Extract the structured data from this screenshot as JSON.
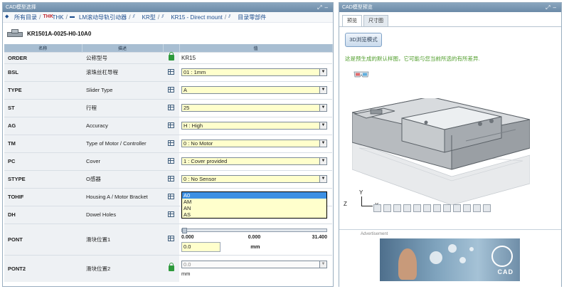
{
  "left_panel": {
    "title": "CAD模型选择",
    "breadcrumb": [
      {
        "label": "所有目录",
        "icon": "catalog-icon"
      },
      {
        "label": "THK",
        "icon": "thk-logo",
        "logo_text": "THK"
      },
      {
        "label": "LM滚动导轨引动器",
        "icon": "guide-icon"
      },
      {
        "label": "KR型",
        "icon": "actuator-icon"
      },
      {
        "label": "KR15 - Direct mount",
        "icon": "actuator-icon"
      },
      {
        "label": "目录零部件",
        "icon": "part-icon"
      }
    ],
    "part_name": "KR1501A-0025-H0-10A0",
    "table": {
      "headers": {
        "name": "名称",
        "description": "描述",
        "value": "值"
      },
      "rows": [
        {
          "key": "ORDER",
          "desc": "公称型号",
          "icon": "lock-icon",
          "value": "KR15"
        },
        {
          "key": "BSL",
          "desc": "滚珠丝杠导程",
          "icon": "table-icon",
          "value": "01 : 1mm"
        },
        {
          "key": "TYPE",
          "desc": "Slider Type",
          "icon": "table-icon",
          "value": "A"
        },
        {
          "key": "ST",
          "desc": "行程",
          "icon": "table-icon",
          "value": "25"
        },
        {
          "key": "AG",
          "desc": "Accuracy",
          "icon": "table-icon",
          "value": "H : High"
        },
        {
          "key": "TM",
          "desc": "Type of Motor / Controller",
          "icon": "table-icon",
          "value": "0 : No Motor"
        },
        {
          "key": "PC",
          "desc": "Cover",
          "icon": "table-icon",
          "value": "1 : Cover provided"
        },
        {
          "key": "STYPE",
          "desc": "O感器",
          "icon": "table-icon",
          "value": "0 : No Sensor"
        },
        {
          "key": "TOHIF",
          "desc": "Housing A / Motor Bracket",
          "icon": "table-icon",
          "options": [
            "A0",
            "AM",
            "AN",
            "AS"
          ],
          "selected": "A0"
        },
        {
          "key": "DH",
          "desc": "Dowel Holes",
          "icon": "table-icon",
          "value": ""
        },
        {
          "key": "PONT",
          "desc": "滑块位置1",
          "icon": "table-icon",
          "range_min": "0.000",
          "range_mid": "0.000",
          "range_max": "31.400",
          "slider_level": 0,
          "input": "0.0",
          "unit": "mm"
        },
        {
          "key": "PONT2",
          "desc": "滑块位置2",
          "icon": "lock-icon",
          "value": "0.0",
          "unit": "mm"
        }
      ]
    }
  },
  "right_panel": {
    "title": "CAD模型预览",
    "tabs": [
      "预览",
      "尺寸图"
    ],
    "active_tab": 0,
    "btn_3d": "3D浏览模式",
    "note": "这是预生成的默认样图，它可能与您当前所选的有所差异.",
    "axis_x": "X",
    "axis_y": "Y",
    "axis_z": "Z",
    "advert_label": "Advertisement",
    "advert_logo": "CAD"
  },
  "colors": {
    "title_bar": "#7a97b3",
    "header": "#a8bed2",
    "field": "#ffffcc",
    "highlight": "#3d90e3",
    "note": "#4f9d2a"
  }
}
